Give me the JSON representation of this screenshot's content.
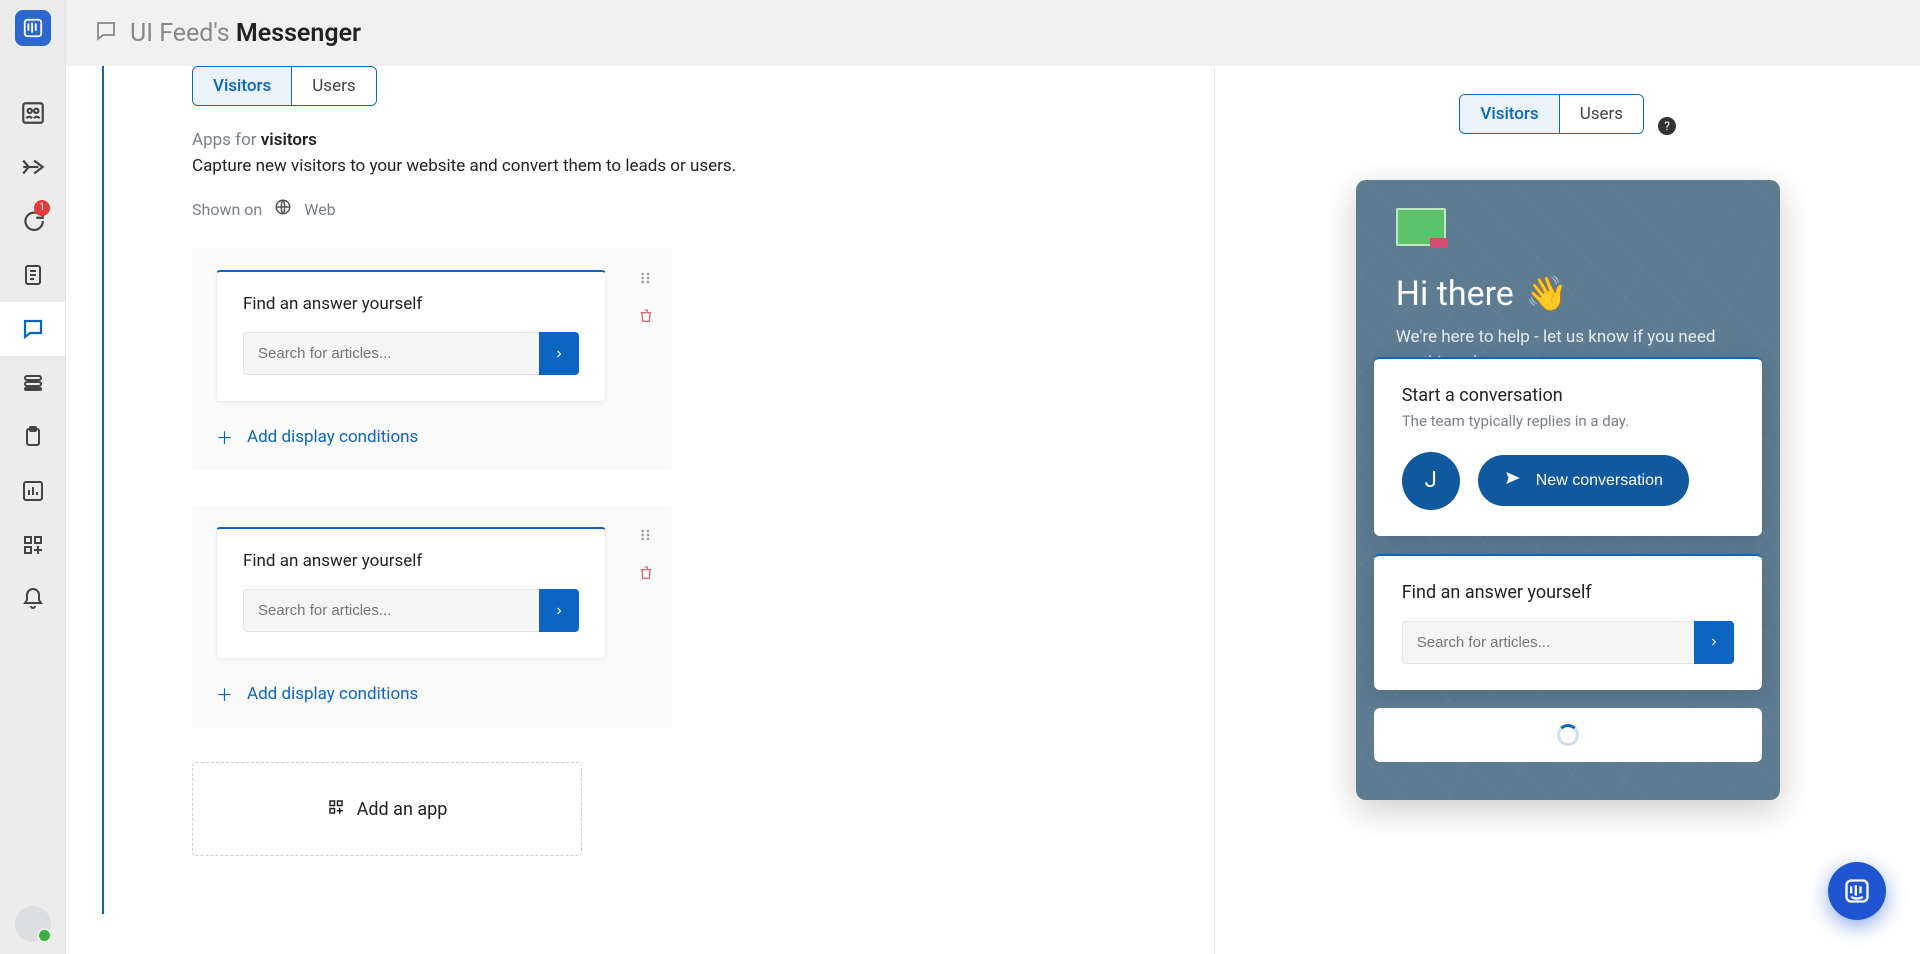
{
  "header": {
    "title_prefix": "UI Feed's ",
    "title_bold": "Messenger"
  },
  "sidebar": {
    "inbox_badge": "1"
  },
  "toggle": {
    "visitors": "Visitors",
    "users": "Users"
  },
  "section": {
    "apps_for_prefix": "Apps for ",
    "apps_for_bold": "visitors",
    "description": "Capture new visitors to your website and convert them to leads or users.",
    "shown_on": "Shown on",
    "web": "Web"
  },
  "app_cards": [
    {
      "title": "Find an answer yourself",
      "placeholder": "Search for articles...",
      "add_conditions": "Add display conditions"
    },
    {
      "title": "Find an answer yourself",
      "placeholder": "Search for articles...",
      "add_conditions": "Add display conditions"
    }
  ],
  "add_app": "Add an app",
  "preview": {
    "greeting": "Hi there",
    "wave": "👋",
    "subtitle": "We're here to help - let us know if you need anything :-)",
    "start_conv": "Start a conversation",
    "reply_time": "The team typically replies in a day.",
    "avatar_initial": "J",
    "new_conversation": "New conversation",
    "find_answer": "Find an answer yourself",
    "search_placeholder": "Search for articles..."
  },
  "help_tooltip": "?"
}
